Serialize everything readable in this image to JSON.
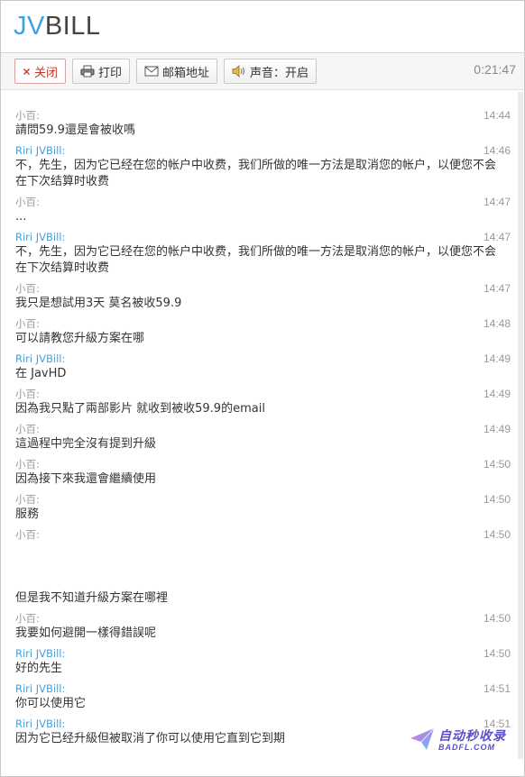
{
  "app": {
    "logo_prefix": "JV",
    "logo_suffix": "BILL"
  },
  "toolbar": {
    "close_label": "关闭",
    "print_label": "打印",
    "email_label": "邮箱地址",
    "sound_label": "声音：开启",
    "timer": "0:21:47"
  },
  "messages": [
    {
      "from": "小百:",
      "role": "customer",
      "time": "14:44",
      "text": "請問59.9還是會被收嗎"
    },
    {
      "from": "Riri JVBill:",
      "role": "agent",
      "time": "14:46",
      "text": "不，先生，因为它已经在您的帐户中收费，我们所做的唯一方法是取消您的帐户，以便您不会在下次结算时收费"
    },
    {
      "from": "小百:",
      "role": "customer",
      "time": "14:47",
      "text": "..."
    },
    {
      "from": "Riri JVBill:",
      "role": "agent",
      "time": "14:47",
      "text": "不，先生，因为它已经在您的帐户中收费，我们所做的唯一方法是取消您的帐户，以便您不会在下次结算时收费"
    },
    {
      "from": "小百:",
      "role": "customer",
      "time": "14:47",
      "text": "我只是想試用3天 莫名被收59.9"
    },
    {
      "from": "小百:",
      "role": "customer",
      "time": "14:48",
      "text": "可以請教您升級方案在哪"
    },
    {
      "from": "Riri JVBill:",
      "role": "agent",
      "time": "14:49",
      "text": "在 JavHD"
    },
    {
      "from": "小百:",
      "role": "customer",
      "time": "14:49",
      "text": "因為我只點了兩部影片 就收到被收59.9的email"
    },
    {
      "from": "小百:",
      "role": "customer",
      "time": "14:49",
      "text": "這過程中完全沒有提到升級"
    },
    {
      "from": "小百:",
      "role": "customer",
      "time": "14:50",
      "text": "因為接下來我還會繼續使用"
    },
    {
      "from": "小百:",
      "role": "customer",
      "time": "14:50",
      "text": "服務"
    },
    {
      "from": "小百:",
      "role": "customer",
      "time": "14:50",
      "text": "\n\n\n但是我不知道升級方案在哪裡"
    },
    {
      "from": "小百:",
      "role": "customer",
      "time": "14:50",
      "text": "我要如何避開一樣得錯誤呢"
    },
    {
      "from": "Riri JVBill:",
      "role": "agent",
      "time": "14:50",
      "text": "好的先生"
    },
    {
      "from": "Riri JVBill:",
      "role": "agent",
      "time": "14:51",
      "text": "你可以使用它"
    },
    {
      "from": "Riri JVBill:",
      "role": "agent",
      "time": "14:51",
      "text": "因为它已经升級但被取消了你可以使用它直到它到期"
    }
  ],
  "watermark": {
    "title": "自动秒收录",
    "subtitle": "BADFL.COM"
  }
}
